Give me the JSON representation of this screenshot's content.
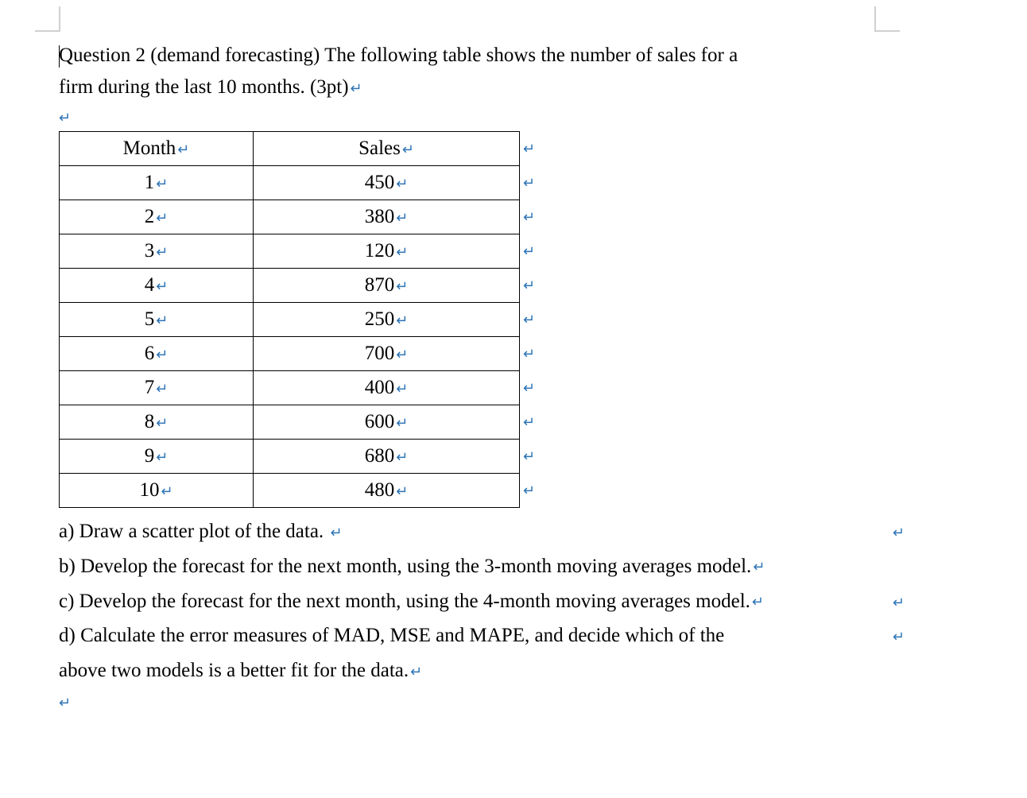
{
  "question": {
    "line1": "Question 2 (demand forecasting) The following table shows the number of sales for a",
    "line2": "firm during the last 10 months. (3pt)"
  },
  "table": {
    "headers": {
      "col1": "Month",
      "col2": "Sales"
    },
    "rows": [
      {
        "month": "1",
        "sales": "450"
      },
      {
        "month": "2",
        "sales": "380"
      },
      {
        "month": "3",
        "sales": "120"
      },
      {
        "month": "4",
        "sales": "870"
      },
      {
        "month": "5",
        "sales": "250"
      },
      {
        "month": "6",
        "sales": "700"
      },
      {
        "month": "7",
        "sales": "400"
      },
      {
        "month": "8",
        "sales": "600"
      },
      {
        "month": "9",
        "sales": "680"
      },
      {
        "month": "10",
        "sales": "480"
      }
    ]
  },
  "subquestions": {
    "a": "a) Draw a scatter plot of the data. ",
    "b": "b) Develop the forecast for the next month, using the 3-month moving averages model.",
    "c": "c) Develop the forecast for the next month, using the 4-month moving averages model.",
    "d_line1": "d) Calculate the error measures of MAD, MSE and MAPE, and decide which of the",
    "d_line2": "above two models is a better fit for the data."
  },
  "marks": {
    "para": "↵",
    "cell": "↵"
  }
}
